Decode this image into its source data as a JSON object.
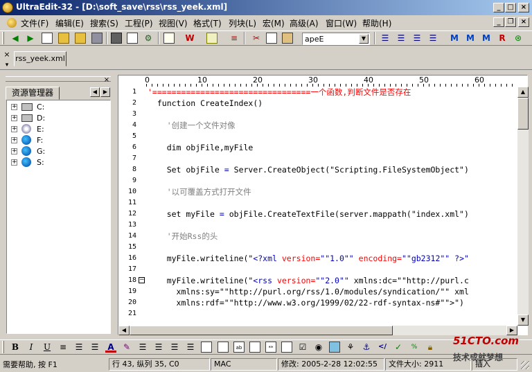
{
  "window": {
    "title": "UltraEdit-32 - [D:\\soft_save\\rss\\rss_yeek.xml]",
    "buttons": [
      "_",
      "□",
      "×"
    ],
    "doc_buttons": [
      "_",
      "❐",
      "×"
    ]
  },
  "menu": [
    "文件(F)",
    "编辑(E)",
    "搜索(S)",
    "工程(P)",
    "视图(V)",
    "格式(T)",
    "列块(L)",
    "宏(M)",
    "高级(A)",
    "窗口(W)",
    "帮助(H)"
  ],
  "toolbar": {
    "font_select_value": "apeE"
  },
  "doc_tab": {
    "label": "rss_yeek.xml"
  },
  "explorer": {
    "tab_label": "资源管理器",
    "drives": [
      "C:",
      "D:",
      "E:",
      "F:",
      "G:",
      "S:"
    ]
  },
  "ruler": {
    "marks": [
      "0",
      "10",
      "20",
      "30",
      "40",
      "50",
      "60"
    ]
  },
  "editor": {
    "line_numbers": [
      "1",
      "2",
      "3",
      "4",
      "5",
      "6",
      "7",
      "8",
      "9",
      "10",
      "11",
      "12",
      "13",
      "14",
      "15",
      "16",
      "17",
      "18",
      "19",
      "20",
      "21"
    ],
    "lines": {
      "l1": "'=================================一个函数,判断文件是否存在",
      "l2": "  function CreateIndex()",
      "l4": "    '创建一个文件对像",
      "l6": "    dim objFile,myFile",
      "l8a": "    Set objFile ",
      "l8b": "=",
      "l8c": " Server.CreateObject(\"Scripting.FileSystemObject\")",
      "l10": "    '以可覆盖方式打开文件",
      "l12a": "    set myFile ",
      "l12b": "=",
      "l12c": " objFile.CreateTextFile(server.mappath(\"index.xml\")",
      "l14": "    '开始Rss的头",
      "l16a": "    myFile.writeline(\"",
      "l16b": "<?xml",
      "l16c": " version=",
      "l16d": "\"\"1.0\"\"",
      "l16e": " encoding=",
      "l16f": "\"\"gb2312\"\"",
      "l16g": " ?>\"",
      "l18a": "    myFile.writeline(\"",
      "l18b": "<rss",
      "l18c": " version=",
      "l18d": "\"\"2.0\"\"",
      "l18e": " xmlns:dc=\"\"http://purl.c",
      "l19": "      xmlns:sy=\"\"http://purl.org/rss/1.0/modules/syndication/\"\" xml",
      "l20": "      xmlns:rdf=\"\"http://www.w3.org/1999/02/22-rdf-syntax-ns#\"\">\")"
    }
  },
  "statusbar": {
    "help": "需要帮助, 按 F1",
    "position": "行 43, 纵列 35, C0",
    "format": "MAC",
    "modified": "修改: 2005-2-28 12:02:55",
    "filesize": "文件大小: 2911",
    "mode": "插入"
  },
  "watermark": {
    "logo": "51CTO.com",
    "slogan": "技术成就梦想"
  },
  "colors": {
    "title_start": "#0a246a",
    "title_end": "#a6caf0",
    "comment_line_red": "#ff0000",
    "keyword_blue": "#0000c0"
  }
}
